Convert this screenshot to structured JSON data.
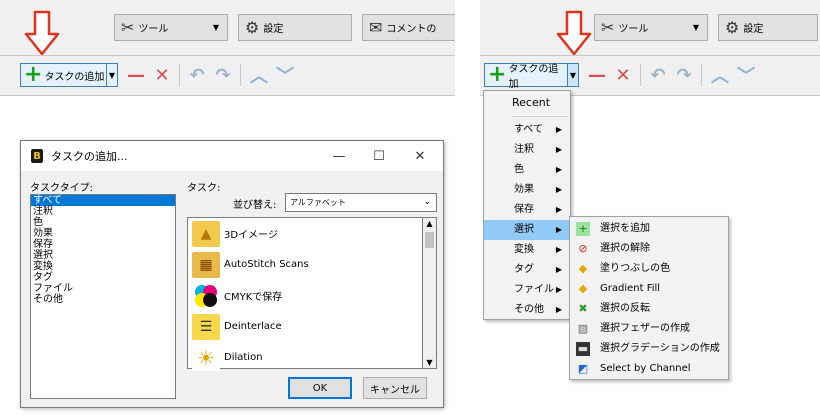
{
  "left": {
    "toolbar": {
      "tools_label": "ツール",
      "settings_label": "設定",
      "comment_label": "コメントの"
    },
    "add_task_label": "タスクの追加",
    "dialog": {
      "title": "タスクの追加...",
      "task_type_label": "タスクタイプ:",
      "task_label": "タスク:",
      "sort_label": "並び替え:",
      "sort_value": "アルファベット",
      "task_types": [
        "すべて",
        "注釈",
        "色",
        "効果",
        "保存",
        "選択",
        "変換",
        "タグ",
        "ファイル",
        "その他"
      ],
      "tasks": [
        "3Dイメージ",
        "AutoStitch Scans",
        "CMYKで保存",
        "Deinterlace",
        "Dilation"
      ],
      "ok_label": "OK",
      "cancel_label": "キャンセル"
    }
  },
  "right": {
    "toolbar": {
      "tools_label": "ツール",
      "settings_label": "設定"
    },
    "add_task_label": "タスクの追加",
    "menu": {
      "recent": "Recent",
      "items": [
        "すべて",
        "注釈",
        "色",
        "効果",
        "保存",
        "選択",
        "変換",
        "タグ",
        "ファイル",
        "その他"
      ],
      "highlighted": "選択"
    },
    "submenu": [
      "選択を追加",
      "選択の解除",
      "塗りつぶしの色",
      "Gradient Fill",
      "選択の反転",
      "選択フェザーの作成",
      "選択グラデーションの作成",
      "Select by Channel"
    ]
  },
  "colors": {
    "accent": "#0078d7",
    "highlight": "#91c9f7",
    "arrow": "#e0331d",
    "plus": "#19a219"
  }
}
